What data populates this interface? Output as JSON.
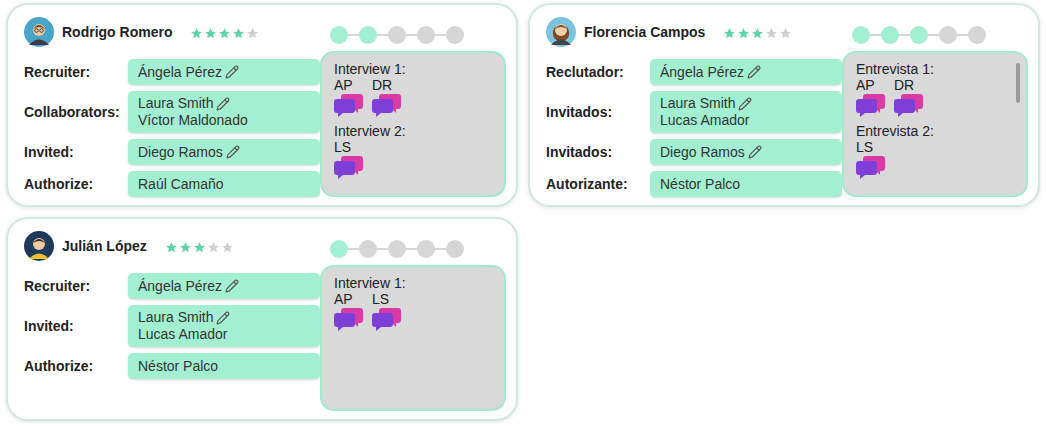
{
  "cards": [
    {
      "name": "Rodrigo Romero",
      "stars": 4,
      "avatar": {
        "kind": "man-glasses"
      },
      "steps": [
        {
          "done": true
        },
        {
          "done": true
        },
        {
          "done": false
        },
        {
          "done": false
        },
        {
          "done": false
        }
      ],
      "fields": [
        {
          "label": "Recruiter:",
          "values": [
            {
              "name": "Ángela Pérez",
              "editable": true
            }
          ]
        },
        {
          "label": "Collaborators:",
          "values": [
            {
              "name": "Laura Smith",
              "editable": true
            },
            {
              "name": "Víctor Maldonado",
              "editable": false
            }
          ]
        },
        {
          "label": "Invited:",
          "values": [
            {
              "name": "Diego Ramos",
              "editable": true
            }
          ]
        },
        {
          "label": "Authorize:",
          "values": [
            {
              "name": "Raúl Camaño",
              "editable": false
            }
          ]
        }
      ],
      "panel": {
        "scrollable": false,
        "interviews": [
          {
            "title": "Interview 1:",
            "participants": [
              "AP",
              "DR"
            ]
          },
          {
            "title": "Interview 2:",
            "participants": [
              "LS"
            ]
          }
        ]
      }
    },
    {
      "name": "Florencia Campos",
      "stars": 3,
      "avatar": {
        "kind": "woman"
      },
      "steps": [
        {
          "done": true
        },
        {
          "done": true
        },
        {
          "done": true
        },
        {
          "done": false
        },
        {
          "done": false
        }
      ],
      "fields": [
        {
          "label": "Reclutador:",
          "values": [
            {
              "name": "Ángela Pérez",
              "editable": true
            }
          ]
        },
        {
          "label": "Invitados:",
          "values": [
            {
              "name": "Laura Smith",
              "editable": true
            },
            {
              "name": "Lucas Amador",
              "editable": false
            }
          ]
        },
        {
          "label": "Invitados:",
          "values": [
            {
              "name": "Diego Ramos",
              "editable": true
            }
          ]
        },
        {
          "label": "Autorizante:",
          "values": [
            {
              "name": "Néstor Palco",
              "editable": false
            }
          ]
        }
      ],
      "panel": {
        "scrollable": true,
        "interviews": [
          {
            "title": "Entrevista 1:",
            "participants": [
              "AP",
              "DR"
            ]
          },
          {
            "title": "Entrevista 2:",
            "participants": [
              "LS"
            ]
          }
        ]
      }
    },
    {
      "name": "Julián López",
      "stars": 3,
      "avatar": {
        "kind": "man-yellow"
      },
      "steps": [
        {
          "done": true
        },
        {
          "done": false
        },
        {
          "done": false
        },
        {
          "done": false
        },
        {
          "done": false
        }
      ],
      "fields": [
        {
          "label": "Recruiter:",
          "values": [
            {
              "name": "Ángela Pérez",
              "editable": true
            }
          ]
        },
        {
          "label": "Invited:",
          "values": [
            {
              "name": "Laura Smith",
              "editable": true
            },
            {
              "name": "Lucas Amador",
              "editable": false
            }
          ]
        },
        {
          "label": "Authorize:",
          "values": [
            {
              "name": "Néstor Palco",
              "editable": false
            }
          ]
        }
      ],
      "panel": {
        "scrollable": false,
        "interviews": [
          {
            "title": "Interview 1:",
            "participants": [
              "AP",
              "LS"
            ]
          }
        ]
      }
    }
  ]
}
